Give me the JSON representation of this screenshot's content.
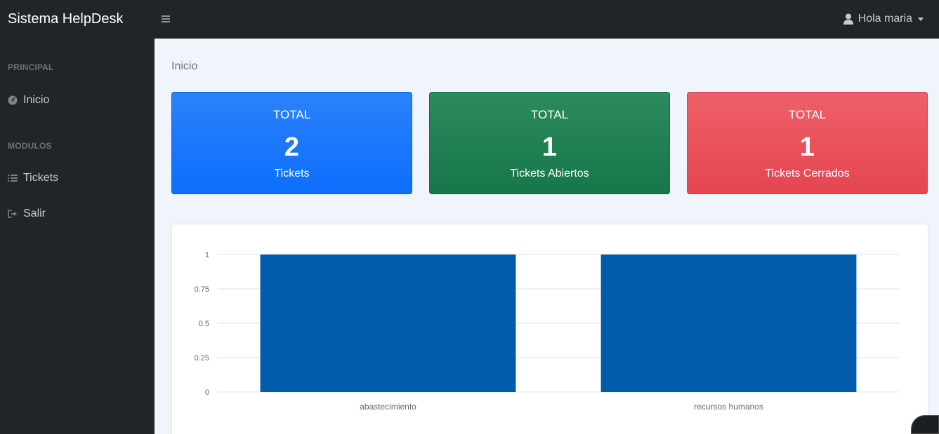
{
  "app": {
    "title": "Sistema HelpDesk"
  },
  "header": {
    "user_label": "Hola maria"
  },
  "sidebar": {
    "sections": [
      {
        "heading": "PRINCIPAL",
        "items": [
          {
            "label": "Inicio",
            "icon": "dashboard-icon"
          }
        ]
      },
      {
        "heading": "MODULOS",
        "items": [
          {
            "label": "Tickets",
            "icon": "list-icon"
          },
          {
            "label": "Salir",
            "icon": "sign-out-icon"
          }
        ]
      }
    ]
  },
  "breadcrumb": "Inicio",
  "cards": [
    {
      "title": "TOTAL",
      "value": "2",
      "label": "Tickets",
      "color": "#0d6efd"
    },
    {
      "title": "TOTAL",
      "value": "1",
      "label": "Tickets Abiertos",
      "color": "#198754"
    },
    {
      "title": "TOTAL",
      "value": "1",
      "label": "Tickets Cerrados",
      "color": "#e44650"
    }
  ],
  "chart_data": {
    "type": "bar",
    "categories": [
      "abastecimiento",
      "recursos humanos"
    ],
    "values": [
      1,
      1
    ],
    "ylim": [
      0,
      1
    ],
    "yticks": [
      "0",
      "0.25",
      "0.5",
      "0.75",
      "1"
    ],
    "grid": true,
    "bar_color": "#005baa"
  }
}
